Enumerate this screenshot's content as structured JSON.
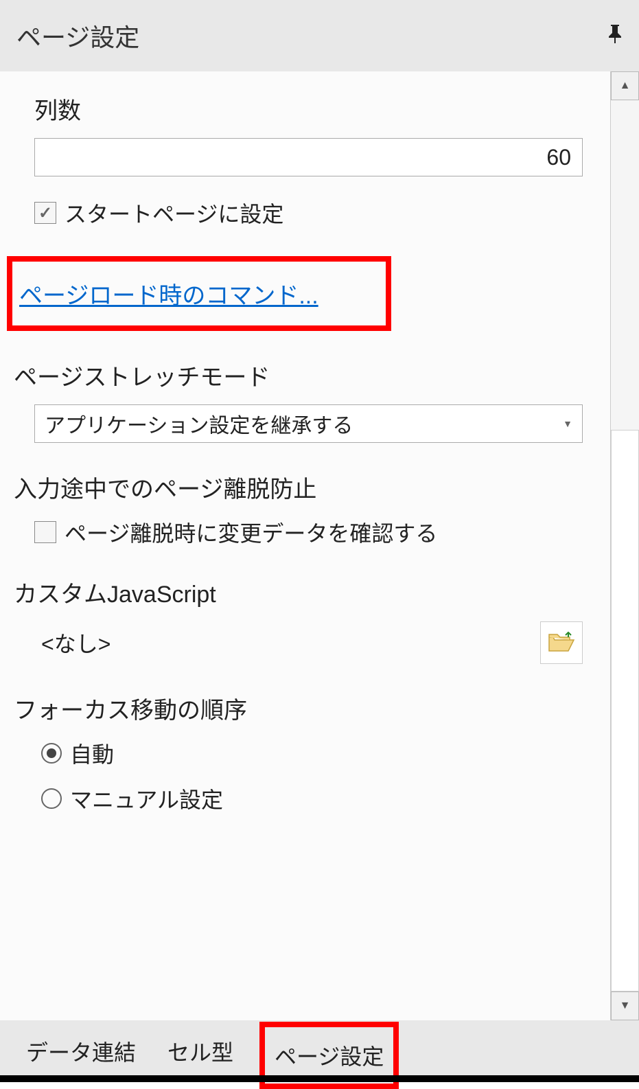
{
  "header": {
    "title": "ページ設定"
  },
  "columns": {
    "label": "列数",
    "value": "60"
  },
  "startpage": {
    "label": "スタートページに設定",
    "checked": true
  },
  "pageload_link": "ページロード時のコマンド...",
  "stretch_mode": {
    "label": "ページストレッチモード",
    "selected": "アプリケーション設定を継承する"
  },
  "leave_prevent": {
    "title": "入力途中でのページ離脱防止",
    "checkbox_label": "ページ離脱時に変更データを確認する",
    "checked": false
  },
  "custom_js": {
    "title": "カスタムJavaScript",
    "placeholder": "<なし>"
  },
  "focus_order": {
    "title": "フォーカス移動の順序",
    "options": [
      {
        "label": "自動",
        "checked": true
      },
      {
        "label": "マニュアル設定",
        "checked": false
      }
    ]
  },
  "tabs": {
    "data_link": "データ連結",
    "cell_type": "セル型",
    "page_settings": "ページ設定"
  }
}
